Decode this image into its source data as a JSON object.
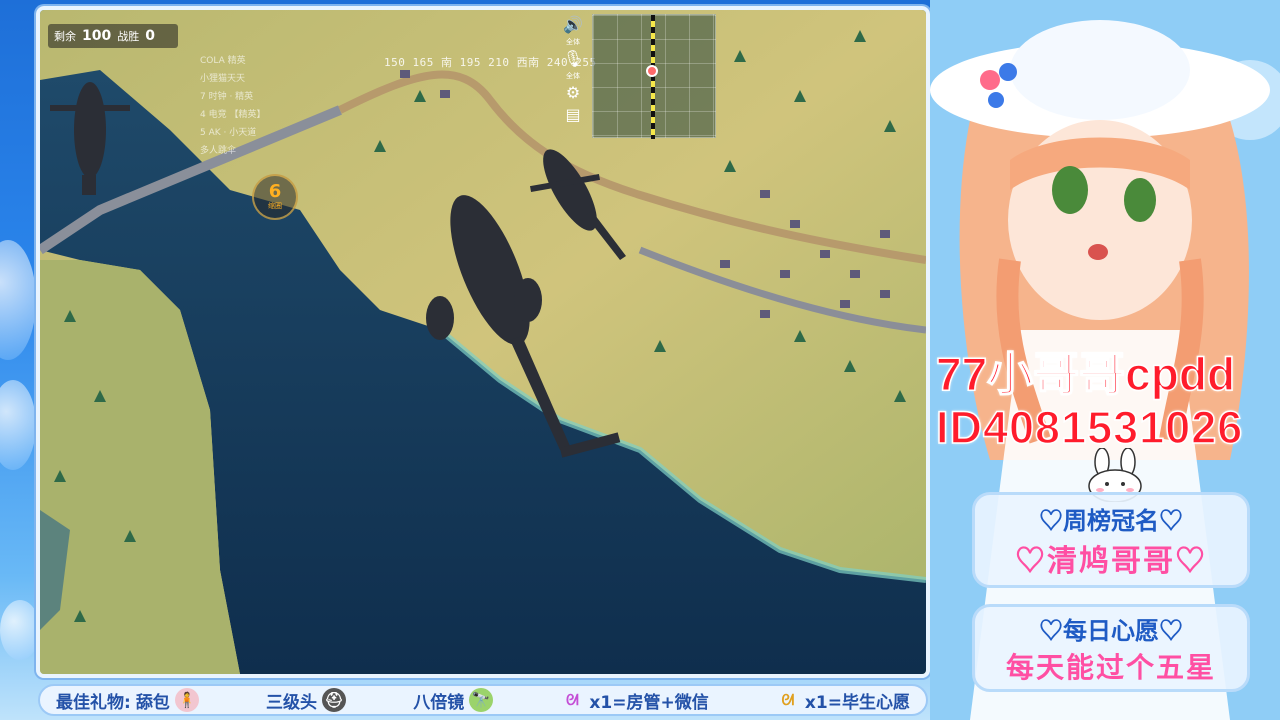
{
  "hud": {
    "remaining_label": "剩余",
    "remaining_count": "100",
    "kills_label": "战胜",
    "kills_count": "0",
    "coords": "150 165 南 195 210 西南 240 255",
    "volume_label": "全体",
    "mic_label": "全体",
    "circle_count": "6",
    "circle_label": "缩圈",
    "killfeed": [
      "COLA 精英",
      "小狸猫天天",
      "7  时钟 · 精英",
      "4  电竞 【精英】",
      "5  AK · 小天道",
      "多人跳伞"
    ]
  },
  "gift_bar": {
    "best_gift_label": "最佳礼物:",
    "gift_1": "舔包",
    "gift_2": "三级头",
    "gift_3": "八倍镜",
    "gift_4": "x1=房管+微信",
    "gift_5": "x1=毕生心愿"
  },
  "streamer": {
    "name": "77小哥哥cpdd",
    "id": "ID4081531026"
  },
  "weekly": {
    "title": "♡周榜冠名♡",
    "value": "♡清鸠哥哥♡"
  },
  "wish": {
    "title": "♡每日心愿♡",
    "value": "每天能过个五星"
  },
  "colors": {
    "frame_bg": "#2b86ec",
    "accent_red": "#ff1c2c",
    "accent_pink": "#ff4fa3",
    "accent_blue": "#1f5bc4"
  }
}
